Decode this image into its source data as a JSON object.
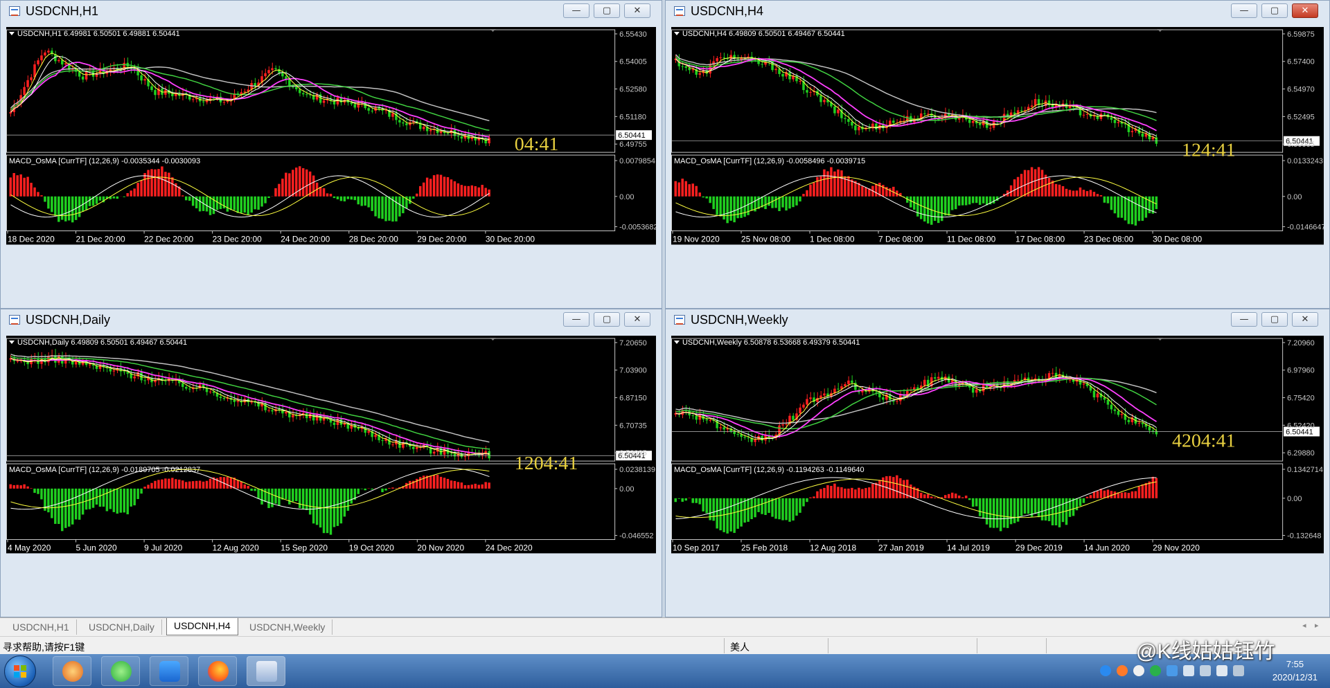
{
  "windows": [
    {
      "id": "h1",
      "title": "USDCNH,H1",
      "header": "USDCNH,H1  6.49981 6.50501 6.49881 6.50441",
      "price_ticks": [
        "6.55430",
        "6.54005",
        "6.52580",
        "6.51180",
        "6.49755"
      ],
      "current_price": "6.50441",
      "countdown": "04:41",
      "indicator_label": "MACD_OsMA [CurrTF] (12,26,9) -0.0035344 -0.0030093",
      "indicator_ticks": [
        "0.0079854",
        "0.00",
        "-0.0053682"
      ],
      "time_ticks": [
        "18 Dec 2020",
        "21 Dec 20:00",
        "22 Dec 20:00",
        "23 Dec 20:00",
        "24 Dec 20:00",
        "28 Dec 20:00",
        "29 Dec 20:00",
        "30 Dec 20:00"
      ],
      "close_active": false
    },
    {
      "id": "h4",
      "title": "USDCNH,H4",
      "header": "USDCNH,H4  6.49809 6.50501 6.49467 6.50441",
      "price_ticks": [
        "6.59875",
        "6.57400",
        "6.54970",
        "6.52495",
        "6.50065"
      ],
      "current_price": "6.50441",
      "countdown": "124:41",
      "indicator_label": "MACD_OsMA [CurrTF] (12,26,9) -0.0058496 -0.0039715",
      "indicator_ticks": [
        "0.0133243",
        "0.00",
        "-0.0146647"
      ],
      "time_ticks": [
        "19 Nov 2020",
        "25 Nov 08:00",
        "1 Dec 08:00",
        "7 Dec 08:00",
        "11 Dec 08:00",
        "17 Dec 08:00",
        "23 Dec 08:00",
        "30 Dec 08:00"
      ],
      "close_active": true
    },
    {
      "id": "daily",
      "title": "USDCNH,Daily",
      "header": "USDCNH,Daily  6.49809 6.50501 6.49467 6.50441",
      "price_ticks": [
        "7.20650",
        "7.03900",
        "6.87150",
        "6.70735",
        "6.53985"
      ],
      "current_price": "6.50441",
      "countdown": "1204:41",
      "indicator_label": "MACD_OsMA [CurrTF] (12,26,9) -0.0189705 -0.0212837",
      "indicator_ticks": [
        "0.0238139",
        "0.00",
        "-0.046552"
      ],
      "time_ticks": [
        "4 May 2020",
        "5 Jun 2020",
        "9 Jul 2020",
        "12 Aug 2020",
        "15 Sep 2020",
        "19 Oct 2020",
        "20 Nov 2020",
        "24 Dec 2020"
      ],
      "close_active": false
    },
    {
      "id": "weekly",
      "title": "USDCNH,Weekly",
      "header": "USDCNH,Weekly  6.50878 6.53668 6.49379 6.50441",
      "price_ticks": [
        "7.20960",
        "6.97960",
        "6.75420",
        "6.52420",
        "6.29880"
      ],
      "current_price": "6.50441",
      "countdown": "4204:41",
      "indicator_label": "MACD_OsMA [CurrTF] (12,26,9) -0.1194263 -0.1149640",
      "indicator_ticks": [
        "0.1342714",
        "0.00",
        "-0.132648"
      ],
      "time_ticks": [
        "10 Sep 2017",
        "25 Feb 2018",
        "12 Aug 2018",
        "27 Jan 2019",
        "14 Jul 2019",
        "29 Dec 2019",
        "14 Jun 2020",
        "29 Nov 2020"
      ],
      "close_active": false
    }
  ],
  "window_buttons": {
    "minimize": "—",
    "maximize": "▢",
    "close": "✕"
  },
  "tabs": [
    {
      "label": "USDCNH,H1",
      "active": false
    },
    {
      "label": "USDCNH,Daily",
      "active": false
    },
    {
      "label": "USDCNH,H4",
      "active": true
    },
    {
      "label": "USDCNH,Weekly",
      "active": false
    }
  ],
  "tab_nav": {
    "prev": "◂",
    "next": "▸"
  },
  "status": {
    "help": "寻求帮助,请按F1键",
    "language": "美人"
  },
  "taskbar": {
    "apps": [
      "start-orb",
      "swirl-app",
      "wechat",
      "feishu",
      "firefox",
      "metatrader"
    ],
    "clock_time": "7:55",
    "clock_date": "2020/12/31"
  },
  "watermark": "@K线姑姑钰竹",
  "colors": {
    "bull": "#ff2020",
    "bear": "#20d020",
    "ma_fast": "#ffff40",
    "ma_mid": "#ffffff",
    "ma_slow": "#ff40ff",
    "ma_green": "#40d040",
    "ma_gray": "#c0c0c0",
    "countdown": "#e8d040"
  },
  "chart_data": [
    {
      "type": "candlestick",
      "symbol": "USDCNH",
      "timeframe": "H1",
      "last": 6.50441,
      "ylim": [
        6.495,
        6.555
      ],
      "indicator": "MACD_OsMA"
    },
    {
      "type": "candlestick",
      "symbol": "USDCNH",
      "timeframe": "H4",
      "last": 6.50441,
      "ylim": [
        6.495,
        6.605
      ],
      "indicator": "MACD_OsMA"
    },
    {
      "type": "candlestick",
      "symbol": "USDCNH",
      "timeframe": "Daily",
      "last": 6.50441,
      "ylim": [
        6.495,
        7.23
      ],
      "indicator": "MACD_OsMA"
    },
    {
      "type": "candlestick",
      "symbol": "USDCNH",
      "timeframe": "Weekly",
      "last": 6.50441,
      "ylim": [
        6.26,
        7.25
      ],
      "indicator": "MACD_OsMA"
    }
  ]
}
